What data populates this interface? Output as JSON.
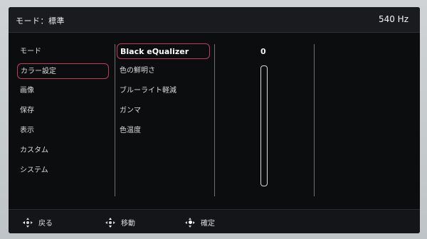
{
  "header": {
    "mode_label": "モード：標準",
    "refresh_rate": "540 Hz"
  },
  "left_menu": {
    "items": [
      {
        "label": "モード"
      },
      {
        "label": "カラー設定"
      },
      {
        "label": "画像"
      },
      {
        "label": "保存"
      },
      {
        "label": "表示"
      },
      {
        "label": "カスタム"
      },
      {
        "label": "システム"
      }
    ],
    "selected_index": 1
  },
  "color_menu": {
    "items": [
      {
        "label": "Black eQualizer"
      },
      {
        "label": "色の鮮明さ"
      },
      {
        "label": "ブルーライト軽減"
      },
      {
        "label": "ガンマ"
      },
      {
        "label": "色温度"
      }
    ],
    "selected_index": 0
  },
  "value_panel": {
    "value": "0",
    "slider_level": 0
  },
  "footer": {
    "back_label": "戻る",
    "move_label": "移動",
    "confirm_label": "確定"
  },
  "colors": {
    "selection_outline": "#c03b5a",
    "background": "#0c0d0f"
  },
  "icons": [
    "joystick-left-icon",
    "joystick-updown-icon",
    "joystick-press-icon"
  ]
}
